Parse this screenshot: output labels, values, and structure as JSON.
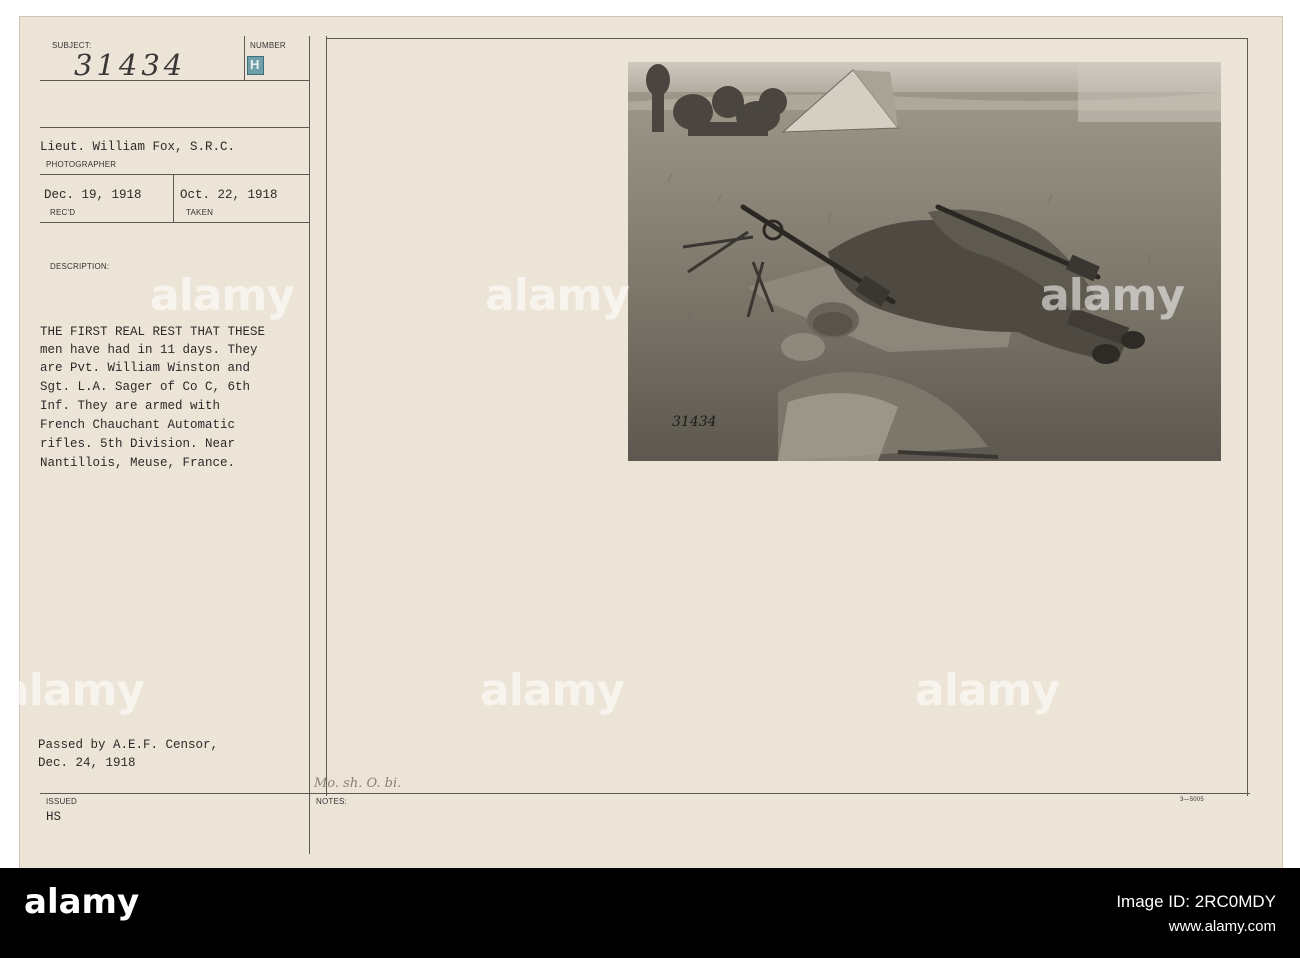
{
  "card": {
    "subject_label": "SUBJECT:",
    "subject_value": "31434",
    "number_label": "NUMBER",
    "number_value": "H",
    "photographer_name": "Lieut. William Fox, S.R.C.",
    "photographer_label": "PHOTOGRAPHER",
    "recd_date": "Dec. 19, 1918",
    "recd_label": "REC'D",
    "taken_date": "Oct. 22, 1918",
    "taken_label": "TAKEN",
    "description_label": "DESCRIPTION:",
    "description_lines": [
      "THE FIRST REAL REST THAT THESE",
      "men have had in 11 days. They",
      "are Pvt. William Winston and",
      "Sgt. L.A. Sager of Co C, 6th",
      "Inf. They are armed with",
      "French Chauchant Automatic",
      "rifles.  5th Division. Near",
      "Nantillois, Meuse, France."
    ],
    "censor_line1": "Passed by A.E.F. Censor,",
    "censor_line2": "Dec. 24, 1918",
    "issued_label": "ISSUED",
    "issued_value": "HS",
    "notes_label": "NOTES:",
    "notes_handwriting": "Mo. sh. O. bi.",
    "form_number": "3—5005",
    "photo_negative_number": "31434"
  },
  "watermark": {
    "text": "alamy"
  },
  "footer": {
    "logo": "alamy",
    "image_id_label": "Image ID: 2RC0MDY",
    "website": "www.alamy.com"
  },
  "colors": {
    "card_bg": "#ede4d8",
    "footer_bg": "#000000",
    "ink": "#2c2a28"
  }
}
